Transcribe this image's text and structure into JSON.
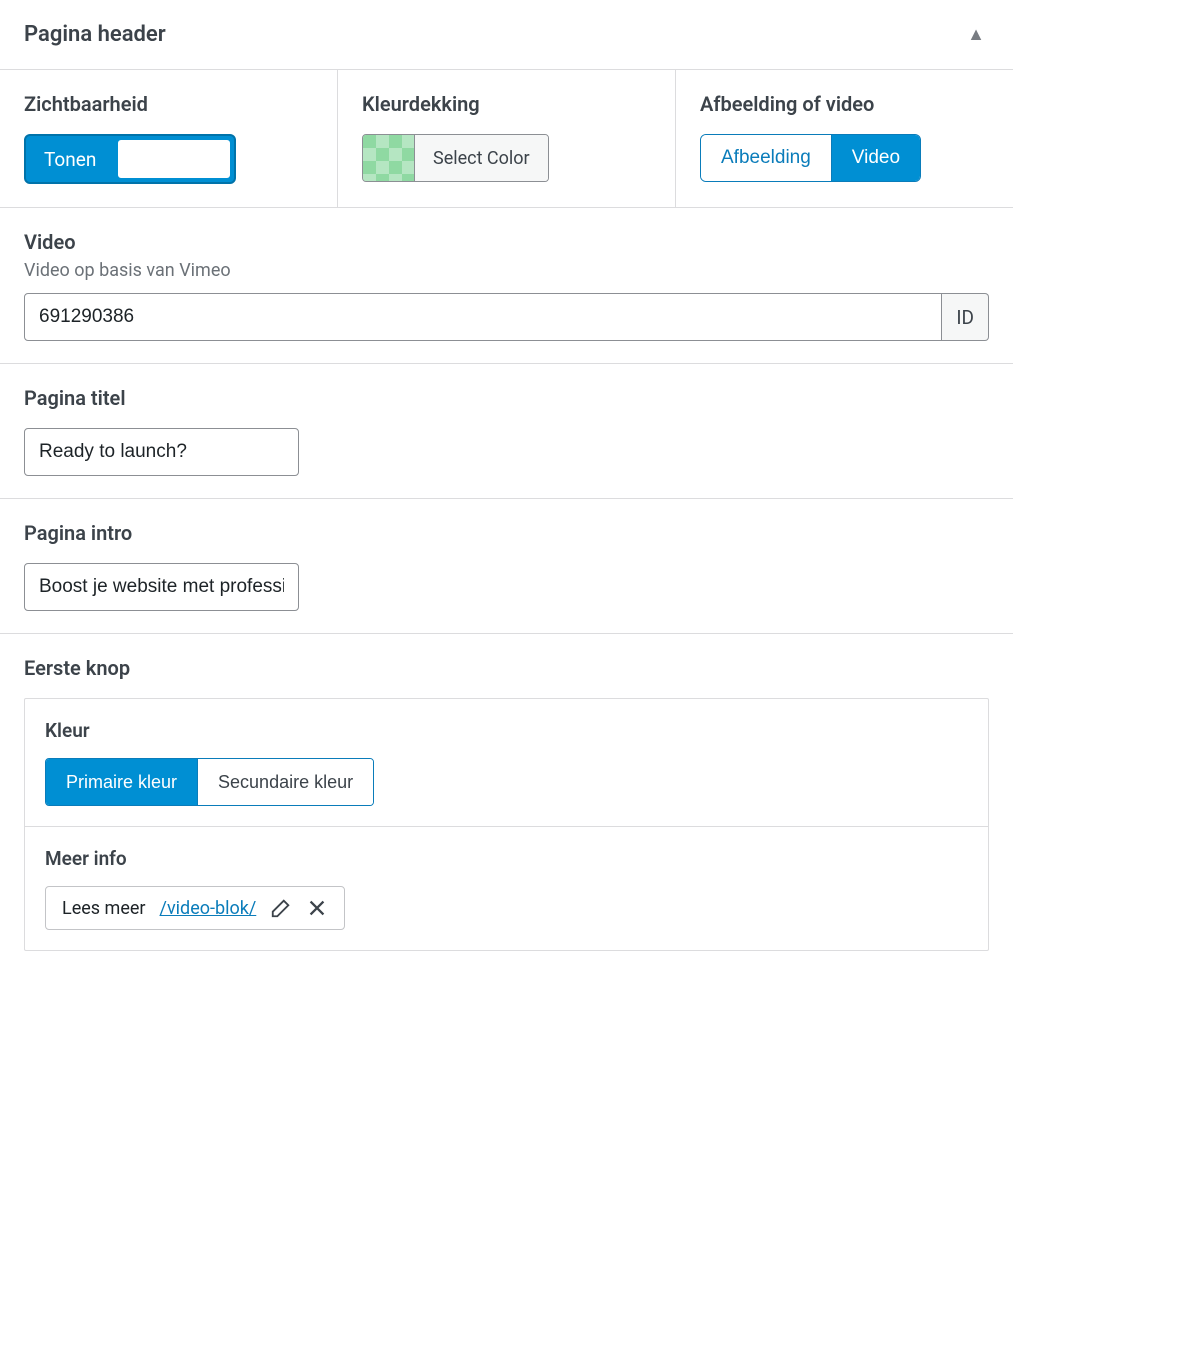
{
  "panel": {
    "title": "Pagina header"
  },
  "visibility": {
    "label": "Zichtbaarheid",
    "active": "Tonen"
  },
  "color_overlay": {
    "label": "Kleurdekking",
    "button": "Select Color"
  },
  "media_type": {
    "label": "Afbeelding of video",
    "options": [
      "Afbeelding",
      "Video"
    ],
    "selected": "Video"
  },
  "video": {
    "label": "Video",
    "helper": "Video op basis van Vimeo",
    "value": "691290386",
    "suffix": "ID"
  },
  "page_title": {
    "label": "Pagina titel",
    "value": "Ready to launch?"
  },
  "page_intro": {
    "label": "Pagina intro",
    "value": "Boost je website met professionele video's"
  },
  "button1": {
    "label": "Eerste knop",
    "color_label": "Kleur",
    "color_options": [
      "Primaire kleur",
      "Secundaire kleur"
    ],
    "color_selected": "Primaire kleur",
    "link_label": "Meer info",
    "link_text": "Lees meer",
    "link_url": "/video-blok/"
  }
}
